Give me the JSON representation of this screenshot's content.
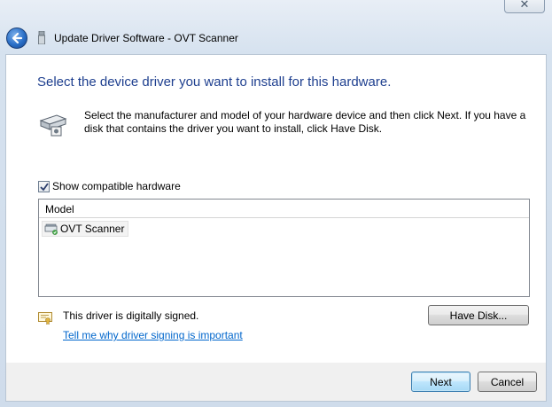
{
  "window": {
    "title": "Update Driver Software - OVT Scanner",
    "close_glyph": "✕"
  },
  "content": {
    "heading": "Select the device driver you want to install for this hardware.",
    "instructions": "Select the manufacturer and model of your hardware device and then click Next. If you have a disk that contains the driver you want to install, click Have Disk.",
    "show_compatible": {
      "label": "Show compatible hardware",
      "checked": true
    },
    "model_list": {
      "column_header": "Model",
      "items": [
        {
          "label": "OVT Scanner",
          "icon": "scanner-driver-icon",
          "selected": true
        }
      ]
    },
    "signed_status": "This driver is digitally signed.",
    "signing_link": "Tell me why driver signing is important",
    "have_disk_label": "Have Disk..."
  },
  "footer": {
    "next_label": "Next",
    "cancel_label": "Cancel"
  },
  "colors": {
    "heading": "#1e3f8f",
    "link": "#0066cc",
    "frame": "#dde8f3"
  }
}
